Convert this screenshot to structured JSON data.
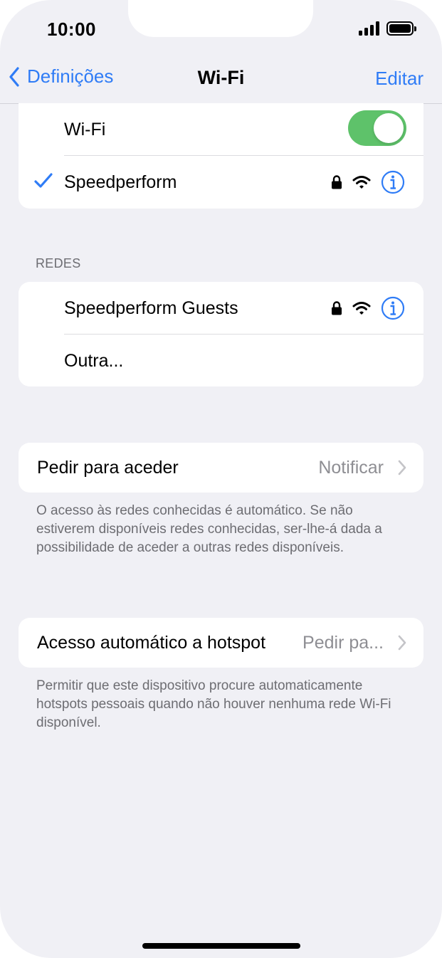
{
  "status_bar": {
    "time": "10:00"
  },
  "nav": {
    "back_label": "Definições",
    "title": "Wi-Fi",
    "edit_label": "Editar"
  },
  "wifi_section": {
    "toggle_label": "Wi-Fi",
    "toggle_on": true,
    "connected_network": "Speedperform"
  },
  "networks_section": {
    "header": "REDES",
    "networks": [
      {
        "name": "Speedperform Guests",
        "secured": true
      },
      {
        "name": "Outra..."
      }
    ]
  },
  "ask_to_join": {
    "label": "Pedir para aceder",
    "value": "Notificar",
    "footnote": "O acesso às redes conhecidas é automático. Se não estiverem disponíveis redes conhecidas, ser-lhe-á dada a possibilidade de aceder a outras redes disponíveis."
  },
  "auto_hotspot": {
    "label": "Acesso automático a hotspot",
    "value": "Pedir pa...",
    "footnote": "Permitir que este dispositivo procure automaticamente hotspots pessoais quando não houver nenhuma rede Wi-Fi disponível."
  },
  "colors": {
    "accent": "#2f7cf6",
    "toggle_on": "#5ec26a",
    "background": "#f0f0f5"
  }
}
